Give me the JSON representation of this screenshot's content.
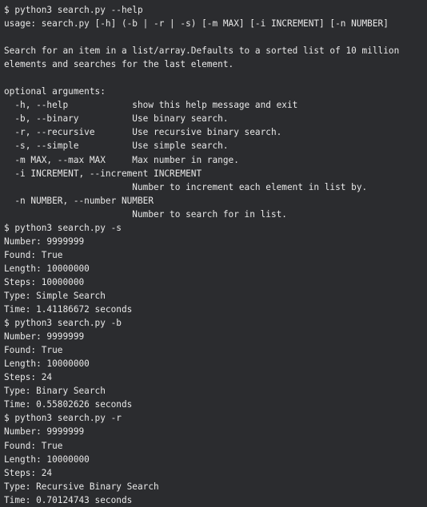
{
  "terminal": {
    "background": "#2b2c2f",
    "foreground": "#e8e8e8",
    "lines": [
      "$ python3 search.py --help",
      "usage: search.py [-h] (-b | -r | -s) [-m MAX] [-i INCREMENT] [-n NUMBER]",
      "",
      "Search for an item in a list/array.Defaults to a sorted list of 10 million",
      "elements and searches for the last element.",
      "",
      "optional arguments:",
      "  -h, --help            show this help message and exit",
      "  -b, --binary          Use binary search.",
      "  -r, --recursive       Use recursive binary search.",
      "  -s, --simple          Use simple search.",
      "  -m MAX, --max MAX     Max number in range.",
      "  -i INCREMENT, --increment INCREMENT",
      "                        Number to increment each element in list by.",
      "  -n NUMBER, --number NUMBER",
      "                        Number to search for in list.",
      "$ python3 search.py -s",
      "Number: 9999999",
      "Found: True",
      "Length: 10000000",
      "Steps: 10000000",
      "Type: Simple Search",
      "Time: 1.41186672 seconds",
      "$ python3 search.py -b",
      "Number: 9999999",
      "Found: True",
      "Length: 10000000",
      "Steps: 24",
      "Type: Binary Search",
      "Time: 0.55802626 seconds",
      "$ python3 search.py -r",
      "Number: 9999999",
      "Found: True",
      "Length: 10000000",
      "Steps: 24",
      "Type: Recursive Binary Search",
      "Time: 0.70124743 seconds"
    ]
  }
}
